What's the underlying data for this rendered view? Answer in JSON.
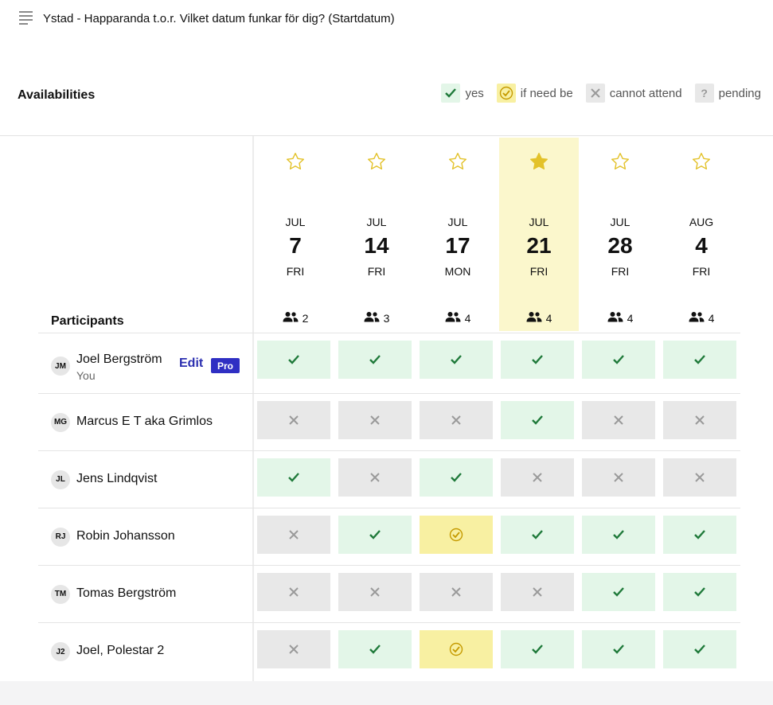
{
  "poll": {
    "description": "Ystad - Happaranda t.o.r. Vilket datum funkar för dig? (Startdatum)"
  },
  "availabilities": {
    "title": "Availabilities",
    "legend": [
      {
        "key": "yes",
        "label": "yes"
      },
      {
        "key": "ifneed",
        "label": "if need be"
      },
      {
        "key": "no",
        "label": "cannot attend"
      },
      {
        "key": "pending",
        "label": "pending"
      }
    ]
  },
  "colors": {
    "yes_bg": "#e3f6e8",
    "yes_mark": "#1f7a3a",
    "ifneed_bg": "#f8f0a2",
    "ifneed_mark": "#c59a00",
    "no_bg": "#e8e8e8",
    "no_mark": "#9a9a9a",
    "highlight": "#fbf7cc",
    "star": "#e3c22a",
    "brand": "#2f2fc3"
  },
  "dates": [
    {
      "month": "JUL",
      "day": "7",
      "dow": "FRI",
      "count": "2",
      "starred": false
    },
    {
      "month": "JUL",
      "day": "14",
      "dow": "FRI",
      "count": "3",
      "starred": false
    },
    {
      "month": "JUL",
      "day": "17",
      "dow": "MON",
      "count": "4",
      "starred": false
    },
    {
      "month": "JUL",
      "day": "21",
      "dow": "FRI",
      "count": "4",
      "starred": true
    },
    {
      "month": "JUL",
      "day": "28",
      "dow": "FRI",
      "count": "4",
      "starred": false
    },
    {
      "month": "AUG",
      "day": "4",
      "dow": "FRI",
      "count": "4",
      "starred": false
    }
  ],
  "participants_label": "Participants",
  "current_user": {
    "sub": "You",
    "edit_label": "Edit",
    "badge": "Pro"
  },
  "participants": [
    {
      "initials": "JM",
      "name": "Joel Bergström",
      "votes": [
        "yes",
        "yes",
        "yes",
        "yes",
        "yes",
        "yes"
      ]
    },
    {
      "initials": "MG",
      "name": "Marcus E T aka Grimlos",
      "votes": [
        "no",
        "no",
        "no",
        "yes",
        "no",
        "no"
      ]
    },
    {
      "initials": "JL",
      "name": "Jens Lindqvist",
      "votes": [
        "yes",
        "no",
        "yes",
        "no",
        "no",
        "no"
      ]
    },
    {
      "initials": "RJ",
      "name": "Robin Johansson",
      "votes": [
        "no",
        "yes",
        "ifneed",
        "yes",
        "yes",
        "yes"
      ]
    },
    {
      "initials": "TM",
      "name": "Tomas Bergström",
      "votes": [
        "no",
        "no",
        "no",
        "no",
        "yes",
        "yes"
      ]
    },
    {
      "initials": "J2",
      "name": "Joel, Polestar 2",
      "votes": [
        "no",
        "yes",
        "ifneed",
        "yes",
        "yes",
        "yes"
      ]
    }
  ]
}
